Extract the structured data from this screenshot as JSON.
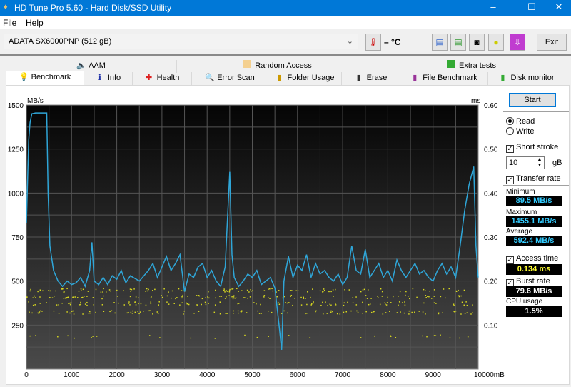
{
  "window": {
    "title": "HD Tune Pro 5.60 - Hard Disk/SSD Utility",
    "minimize": "–",
    "maximize": "☐",
    "close": "✕"
  },
  "menu": [
    "File",
    "Help"
  ],
  "toolbar": {
    "drive": "ADATA SX6000PNP (512 gB)",
    "temperature": "– °C",
    "exit": "Exit",
    "icons": [
      "copy-info-icon",
      "copy-screenshot-icon",
      "camera-icon",
      "coins-icon",
      "download-icon"
    ]
  },
  "tabs_top": [
    {
      "label": "AAM",
      "icon": "speaker-icon"
    },
    {
      "label": "Random Access",
      "icon": "random-access-icon"
    },
    {
      "label": "Extra tests",
      "icon": "extra-tests-icon"
    }
  ],
  "tabs_bottom": [
    {
      "label": "Benchmark",
      "icon": "lightbulb-icon",
      "active": true
    },
    {
      "label": "Info",
      "icon": "info-icon"
    },
    {
      "label": "Health",
      "icon": "health-cross-icon"
    },
    {
      "label": "Error Scan",
      "icon": "magnifier-icon"
    },
    {
      "label": "Folder Usage",
      "icon": "folder-icon"
    },
    {
      "label": "Erase",
      "icon": "trash-icon"
    },
    {
      "label": "File Benchmark",
      "icon": "file-benchmark-icon"
    },
    {
      "label": "Disk monitor",
      "icon": "disk-monitor-icon"
    }
  ],
  "side": {
    "start": "Start",
    "read": "Read",
    "write": "Write",
    "short_stroke": "Short stroke",
    "stroke_value": "10",
    "stroke_unit": "gB",
    "transfer_rate": "Transfer rate",
    "minimum_label": "Minimum",
    "minimum": "89.5 MB/s",
    "maximum_label": "Maximum",
    "maximum": "1455.1 MB/s",
    "average_label": "Average",
    "average": "592.4 MB/s",
    "access_time_label": "Access time",
    "access_time": "0.134 ms",
    "burst_rate_label": "Burst rate",
    "burst_rate": "79.6 MB/s",
    "cpu_label": "CPU usage",
    "cpu": "1.5%",
    "colors": {
      "rate": "#33ccff",
      "access": "#ffff33",
      "burst": "#ffffff"
    }
  },
  "chart_data": {
    "type": "line",
    "ylabel_left": "MB/s",
    "ylabel_right": "ms",
    "xunit": "mB",
    "xlim": [
      0,
      10000
    ],
    "ylim": [
      0,
      1500
    ],
    "y2lim": [
      0,
      0.6
    ],
    "xticks": [
      "0",
      "1000",
      "2000",
      "3000",
      "4000",
      "5000",
      "6000",
      "7000",
      "8000",
      "9000",
      "10000mB"
    ],
    "yticks": [
      "1500",
      "1250",
      "1000",
      "750",
      "500",
      "250"
    ],
    "y2ticks": [
      "0.60",
      "0.50",
      "0.40",
      "0.30",
      "0.20",
      "0.10"
    ],
    "grid": true,
    "colors": {
      "rate": "#2fa6d8",
      "access": "#d8d820"
    },
    "transfer_rate": {
      "x": [
        0,
        50,
        80,
        120,
        200,
        450,
        480,
        520,
        600,
        700,
        800,
        900,
        1000,
        1100,
        1200,
        1300,
        1400,
        1450,
        1500,
        1600,
        1700,
        1800,
        1900,
        2000,
        2100,
        2200,
        2300,
        2500,
        2700,
        2800,
        2900,
        3000,
        3100,
        3200,
        3300,
        3400,
        3500,
        3600,
        3700,
        3800,
        3900,
        4000,
        4100,
        4200,
        4300,
        4400,
        4500,
        4550,
        4600,
        4700,
        4800,
        4900,
        5000,
        5100,
        5200,
        5300,
        5400,
        5500,
        5600,
        5650,
        5700,
        5800,
        5900,
        6000,
        6100,
        6200,
        6300,
        6400,
        6500,
        6600,
        6700,
        6800,
        6900,
        7000,
        7100,
        7200,
        7300,
        7400,
        7500,
        7600,
        7700,
        7800,
        7900,
        8000,
        8100,
        8200,
        8300,
        8400,
        8500,
        8600,
        8700,
        8800,
        8900,
        9000,
        9100,
        9200,
        9300,
        9400,
        9500,
        9600,
        9700,
        9800,
        9900,
        9950,
        10000
      ],
      "y": [
        830,
        1300,
        1400,
        1450,
        1455,
        1455,
        1000,
        700,
        560,
        500,
        470,
        500,
        480,
        490,
        520,
        470,
        560,
        720,
        500,
        480,
        520,
        480,
        530,
        510,
        560,
        490,
        530,
        500,
        560,
        600,
        520,
        580,
        640,
        560,
        600,
        650,
        440,
        540,
        520,
        580,
        600,
        520,
        560,
        500,
        470,
        580,
        1120,
        650,
        520,
        470,
        500,
        540,
        520,
        560,
        480,
        500,
        520,
        460,
        230,
        110,
        500,
        640,
        520,
        590,
        560,
        650,
        520,
        600,
        540,
        560,
        520,
        500,
        540,
        480,
        520,
        700,
        560,
        540,
        680,
        520,
        560,
        600,
        520,
        560,
        500,
        620,
        560,
        520,
        560,
        600,
        540,
        560,
        520,
        500,
        560,
        600,
        540,
        580,
        520,
        700,
        900,
        1050,
        1150,
        700,
        520
      ]
    },
    "access_time_bands_ms": [
      0.18,
      0.165,
      0.15,
      0.13,
      0.075
    ]
  }
}
